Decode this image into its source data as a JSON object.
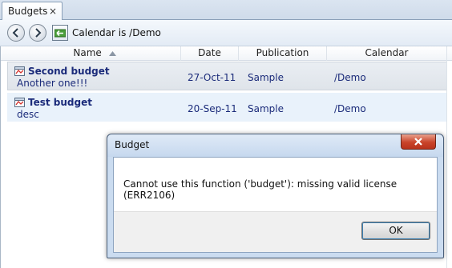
{
  "tabs": [
    {
      "label": "Budgets",
      "close_glyph": "×"
    }
  ],
  "toolbar": {
    "back_icon": "arrow-left-icon",
    "forward_icon": "arrow-right-icon",
    "up_icon": "folder-up-icon",
    "breadcrumb": "Calendar is /Demo"
  },
  "grid": {
    "columns": [
      "Name",
      "Date",
      "Publication",
      "Calendar"
    ],
    "sorted_column": "Name",
    "sort_direction": "ascending",
    "rows": [
      {
        "title": "Second budget",
        "description": "Another one!!!",
        "date": "27-Oct-11",
        "publication": "Sample",
        "calendar": "/Demo",
        "icon": "budget-document-icon"
      },
      {
        "title": "Test budget",
        "description": "desc",
        "date": "20-Sep-11",
        "publication": "Sample",
        "calendar": "/Demo",
        "icon": "budget-document-icon"
      }
    ]
  },
  "dialog": {
    "title": "Budget",
    "message": "Cannot use this function ('budget'): missing valid license (ERR2106)",
    "ok_label": "OK",
    "close_icon": "close-icon"
  },
  "colors": {
    "row_text": "#1b2b7a",
    "close_button": "#c9442a",
    "ok_focus": "#3c7fb1"
  }
}
